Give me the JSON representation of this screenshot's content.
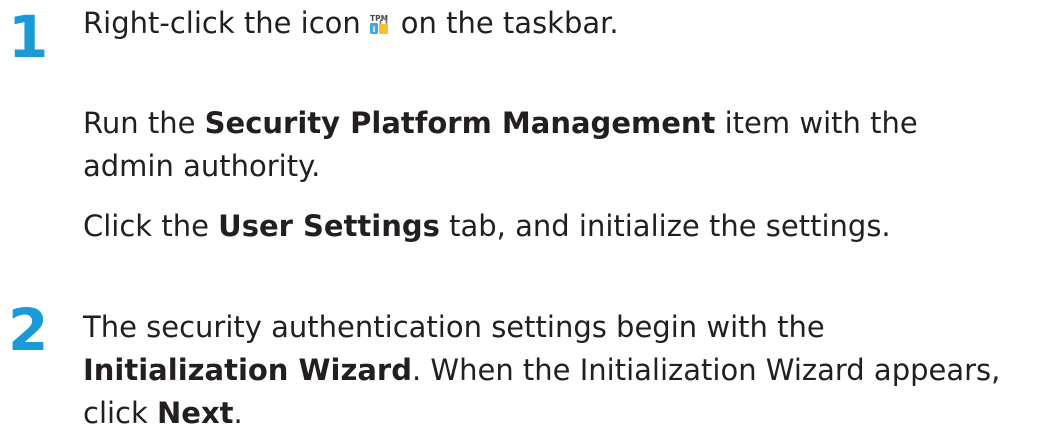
{
  "steps": [
    {
      "number": "1",
      "paragraphs": [
        {
          "pre": "Right-click the icon",
          "icon": "tpm-tray-icon",
          "icon_text": "TPM",
          "post": "on the taskbar."
        },
        {
          "line1_pre": "Run the ",
          "line1_bold": "Security Platform Management",
          "line1_post": " item with the",
          "line2": "admin authority."
        },
        {
          "pre": "Click the ",
          "bold": "User Settings",
          "post": " tab, and initialize the settings."
        }
      ]
    },
    {
      "number": "2",
      "paragraphs": [
        {
          "line1": "The security authentication settings begin with the",
          "line2_bold": "Initialization Wizard",
          "line2_post": ". When the Initialization Wizard appears,",
          "line3_pre": "click ",
          "line3_bold": "Next",
          "line3_post": "."
        }
      ]
    }
  ],
  "colors": {
    "step_number": "#1a9ad6",
    "text": "#231f20"
  }
}
